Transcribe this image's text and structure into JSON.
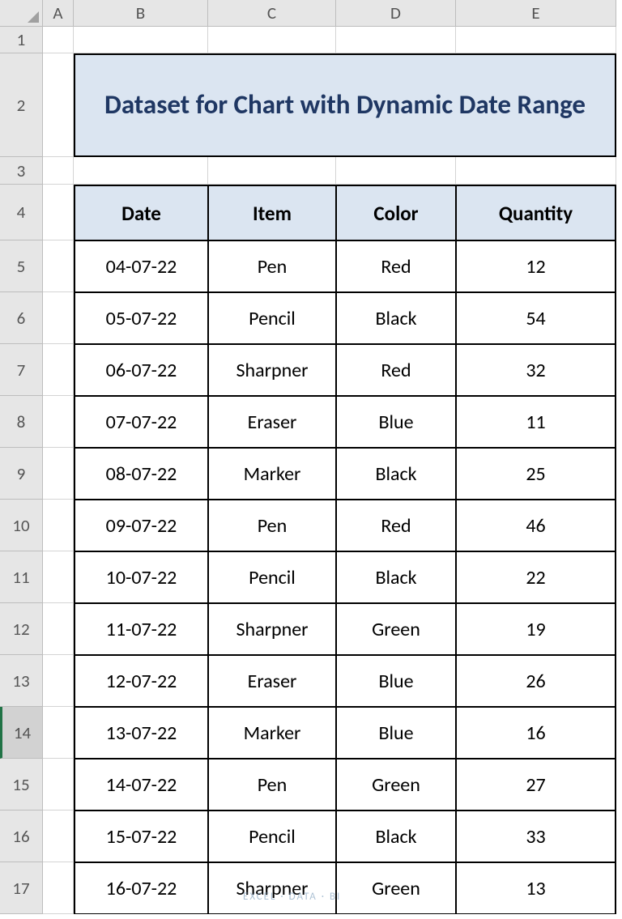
{
  "columns": [
    "A",
    "B",
    "C",
    "D",
    "E"
  ],
  "row_numbers": [
    1,
    2,
    3,
    4,
    5,
    6,
    7,
    8,
    9,
    10,
    11,
    12,
    13,
    14,
    15,
    16,
    17
  ],
  "selected_row": 14,
  "title": "Dataset for Chart with Dynamic Date Range",
  "table_headers": [
    "Date",
    "Item",
    "Color",
    "Quantity"
  ],
  "rows": [
    {
      "date": "04-07-22",
      "item": "Pen",
      "color": "Red",
      "quantity": "12"
    },
    {
      "date": "05-07-22",
      "item": "Pencil",
      "color": "Black",
      "quantity": "54"
    },
    {
      "date": "06-07-22",
      "item": "Sharpner",
      "color": "Red",
      "quantity": "32"
    },
    {
      "date": "07-07-22",
      "item": "Eraser",
      "color": "Blue",
      "quantity": "11"
    },
    {
      "date": "08-07-22",
      "item": "Marker",
      "color": "Black",
      "quantity": "25"
    },
    {
      "date": "09-07-22",
      "item": "Pen",
      "color": "Red",
      "quantity": "46"
    },
    {
      "date": "10-07-22",
      "item": "Pencil",
      "color": "Black",
      "quantity": "22"
    },
    {
      "date": "11-07-22",
      "item": "Sharpner",
      "color": "Green",
      "quantity": "19"
    },
    {
      "date": "12-07-22",
      "item": "Eraser",
      "color": "Blue",
      "quantity": "26"
    },
    {
      "date": "13-07-22",
      "item": "Marker",
      "color": "Blue",
      "quantity": "16"
    },
    {
      "date": "14-07-22",
      "item": "Pen",
      "color": "Green",
      "quantity": "27"
    },
    {
      "date": "15-07-22",
      "item": "Pencil",
      "color": "Black",
      "quantity": "33"
    },
    {
      "date": "16-07-22",
      "item": "Sharpner",
      "color": "Green",
      "quantity": "13"
    }
  ],
  "watermark": "EXCEL · DATA · BI"
}
